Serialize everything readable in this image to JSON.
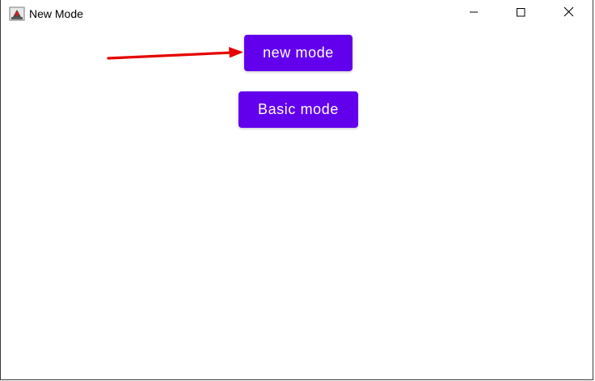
{
  "window": {
    "title": "New Mode",
    "app_icon": "java-cup-icon",
    "controls": {
      "minimize": "minimize-icon",
      "maximize": "maximize-icon",
      "close": "close-icon"
    }
  },
  "buttons": {
    "new_mode": "new mode",
    "basic_mode": "Basic mode"
  },
  "annotation": {
    "arrow_icon": "red-arrow-icon",
    "arrow_color": "#e60000"
  },
  "colors": {
    "button_bg": "#6200ee",
    "button_text": "#ffffff"
  }
}
